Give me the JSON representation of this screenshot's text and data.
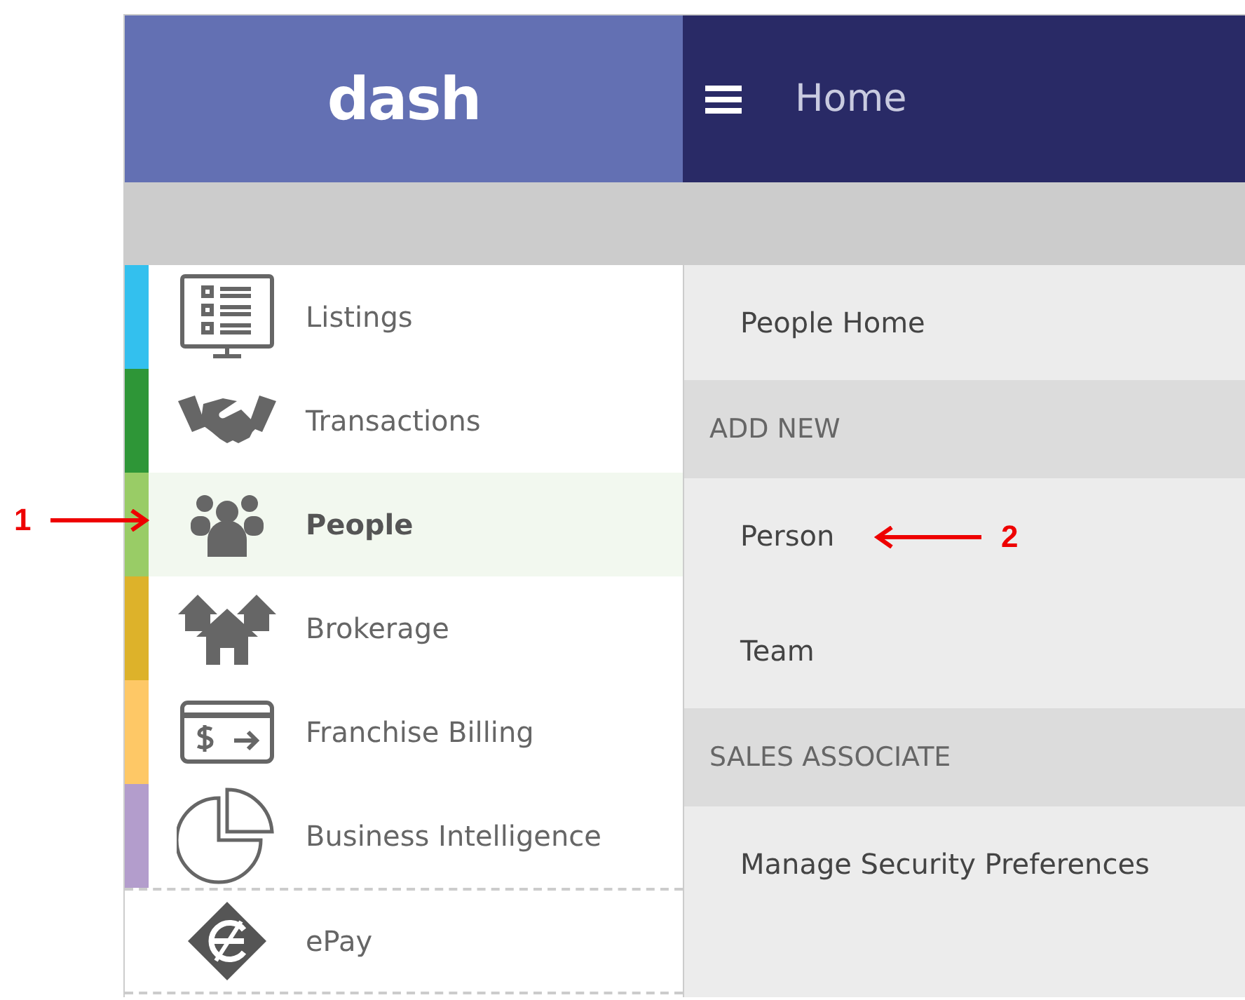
{
  "header": {
    "logo": "dash",
    "title": "Home"
  },
  "sidebar": {
    "items": [
      {
        "label": "Listings",
        "color": "#33c0ee",
        "selected": false
      },
      {
        "label": "Transactions",
        "color": "#2e9637",
        "selected": false
      },
      {
        "label": "People",
        "color": "#99cc66",
        "selected": true
      },
      {
        "label": "Brokerage",
        "color": "#ddb22a",
        "selected": false
      },
      {
        "label": "Franchise Billing",
        "color": "#fec866",
        "selected": false
      },
      {
        "label": "Business Intelligence",
        "color": "#b39dcc",
        "selected": false
      },
      {
        "label": "ePay",
        "selected": false
      }
    ]
  },
  "submenu": {
    "items": [
      {
        "kind": "link",
        "label": "People Home"
      },
      {
        "kind": "header",
        "label": "ADD NEW"
      },
      {
        "kind": "link",
        "label": "Person"
      },
      {
        "kind": "link",
        "label": "Team"
      },
      {
        "kind": "header",
        "label": "SALES ASSOCIATE"
      },
      {
        "kind": "link",
        "label": "Manage Security Preferences"
      }
    ]
  },
  "annotations": [
    {
      "label": "1"
    },
    {
      "label": "2"
    }
  ]
}
